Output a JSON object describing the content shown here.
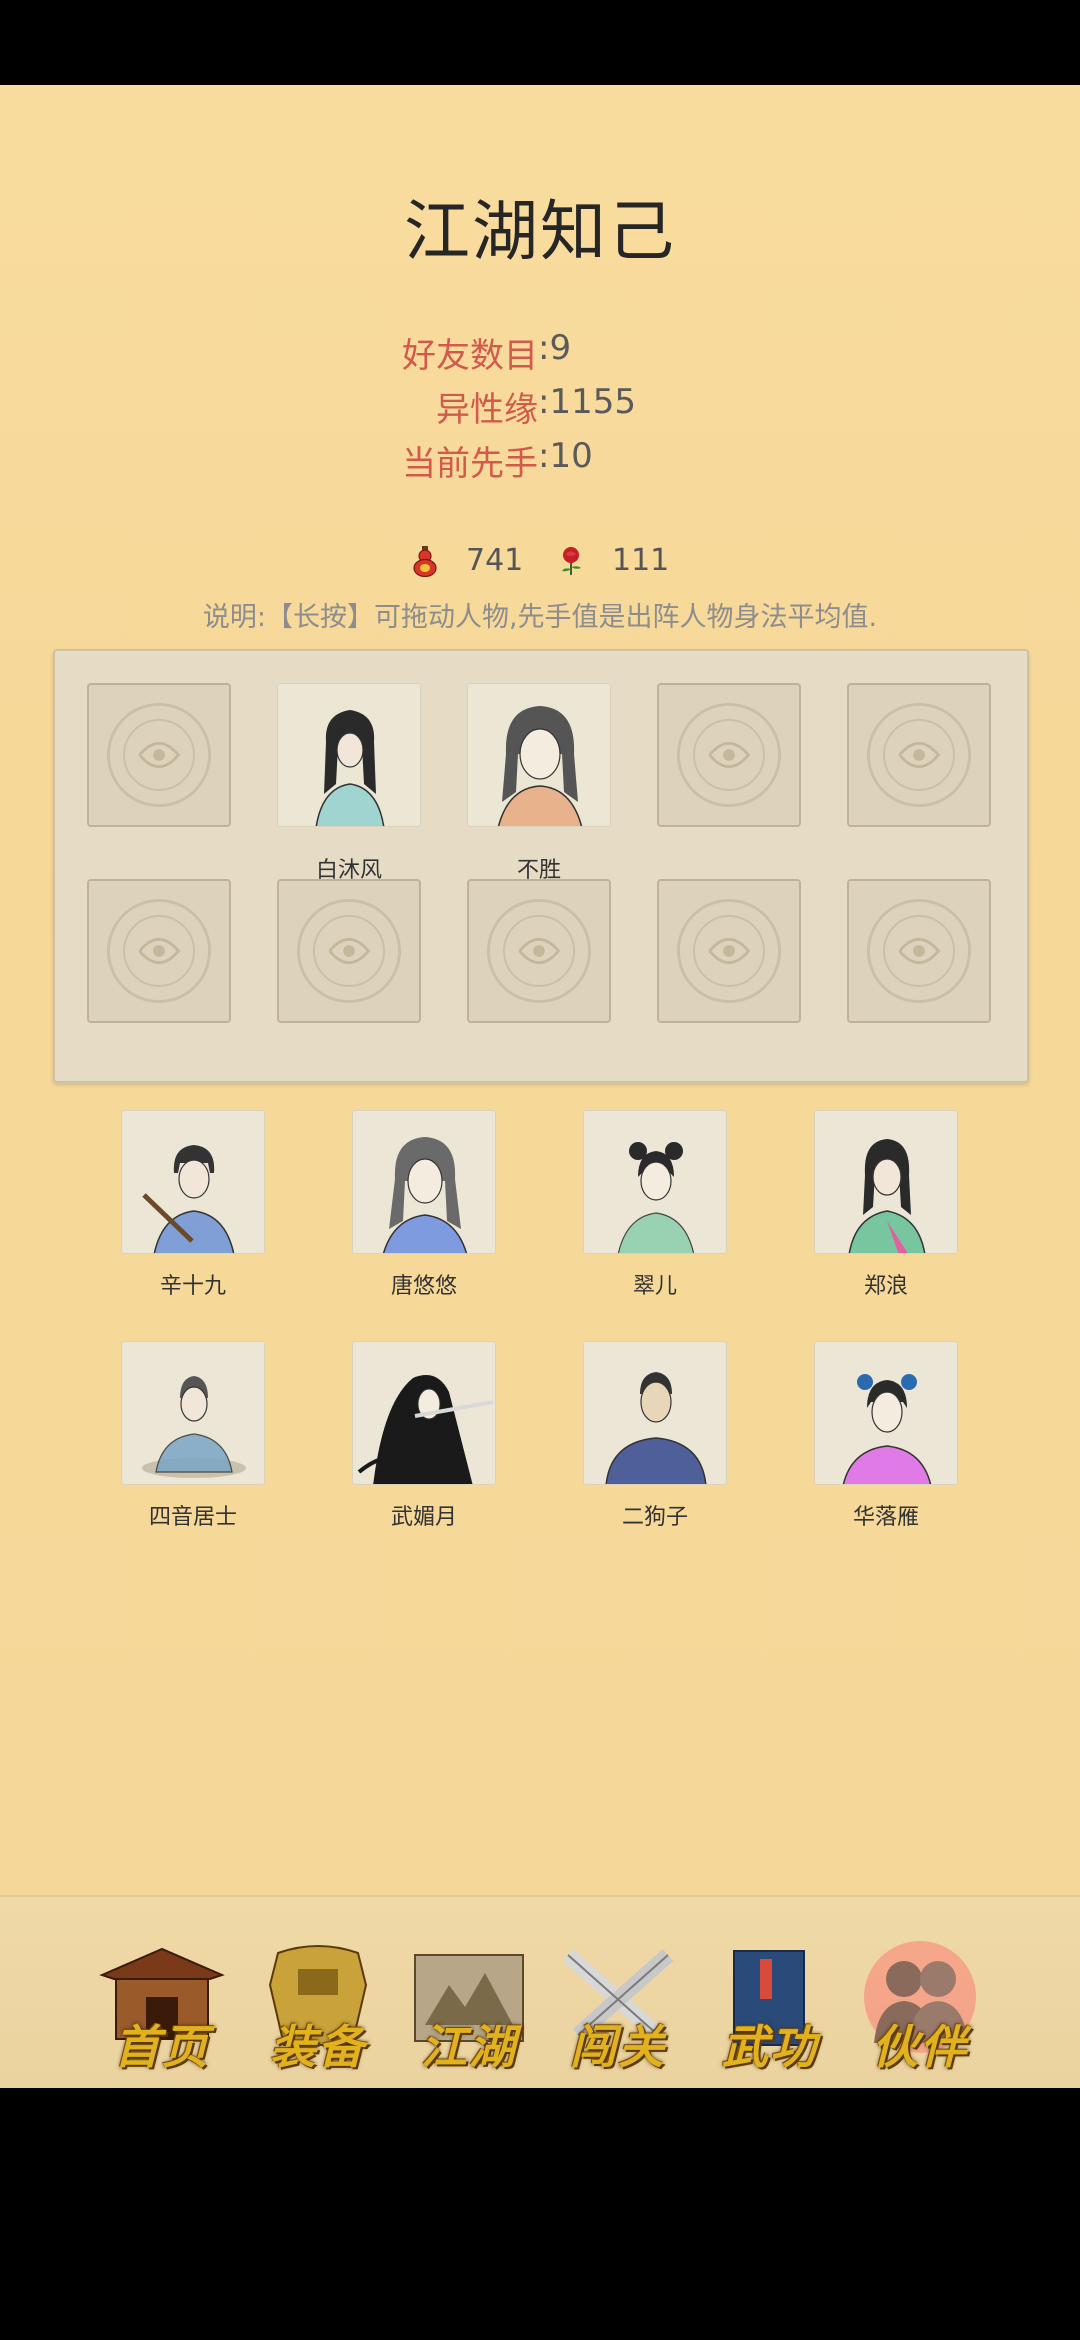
{
  "page": {
    "title": "江湖知己"
  },
  "stats": [
    {
      "key": "好友数目",
      "value": "9"
    },
    {
      "key": "异性缘",
      "value": "1155"
    },
    {
      "key": "当前先手",
      "value": "10"
    }
  ],
  "currency": {
    "gourd": {
      "icon": "gourd-icon",
      "value": "741"
    },
    "rose": {
      "icon": "rose-icon",
      "value": "111"
    }
  },
  "note": "说明:【长按】可拖动人物,先手值是出阵人物身法平均值.",
  "team_slots": [
    {
      "name": "",
      "filled": false
    },
    {
      "name": "白沐风",
      "filled": true
    },
    {
      "name": "不胜",
      "filled": true
    },
    {
      "name": "",
      "filled": false
    },
    {
      "name": "",
      "filled": false
    },
    {
      "name": "",
      "filled": false
    },
    {
      "name": "",
      "filled": false
    },
    {
      "name": "",
      "filled": false
    },
    {
      "name": "",
      "filled": false
    },
    {
      "name": "",
      "filled": false
    }
  ],
  "companions": [
    {
      "name": "辛十九"
    },
    {
      "name": "唐悠悠"
    },
    {
      "name": "翠儿"
    },
    {
      "name": "郑浪"
    },
    {
      "name": "四音居士"
    },
    {
      "name": "武媚月"
    },
    {
      "name": "二狗子"
    },
    {
      "name": "华落雁"
    }
  ],
  "nav": [
    {
      "label": "首页",
      "icon": "temple-icon"
    },
    {
      "label": "装备",
      "icon": "armor-icon"
    },
    {
      "label": "江湖",
      "icon": "scroll-map-icon"
    },
    {
      "label": "闯关",
      "icon": "crossed-swords-icon"
    },
    {
      "label": "武功",
      "icon": "book-icon"
    },
    {
      "label": "伙伴",
      "icon": "companions-icon",
      "active": true
    }
  ],
  "colors": {
    "background": "#f6d898",
    "stat_key": "#d25a4a",
    "nav_label": "#e2b21e"
  }
}
